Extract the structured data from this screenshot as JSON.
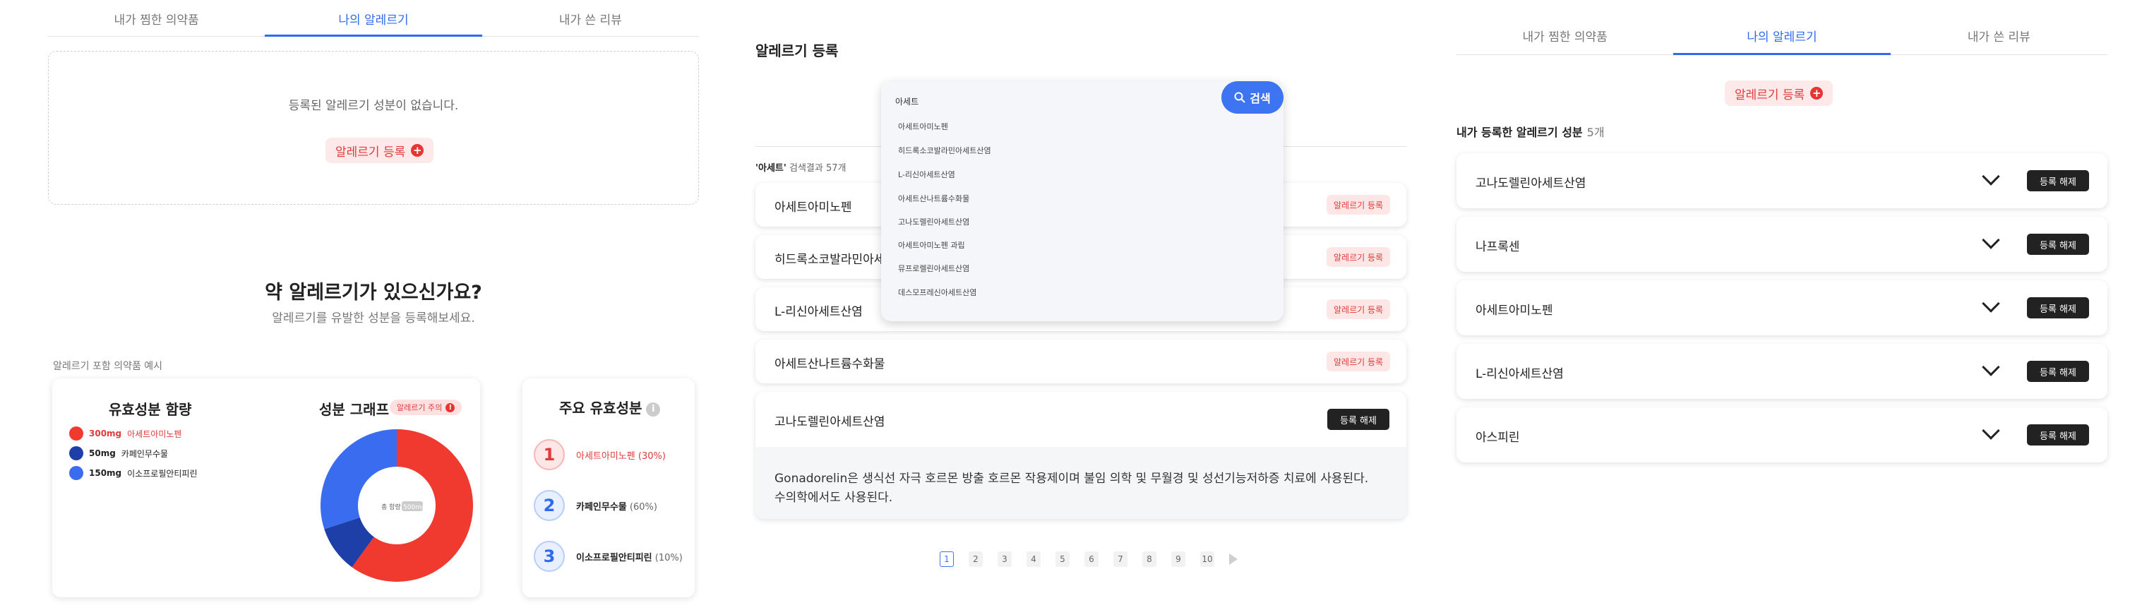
{
  "tabs": [
    {
      "label": "내가 찜한 의약품"
    },
    {
      "label": "나의 알레르기"
    },
    {
      "label": "내가 쓴 리뷰"
    }
  ],
  "empty_state": {
    "message": "등록된 알레르기 성분이 없습니다.",
    "register_label": "알레르기 등록"
  },
  "promo": {
    "headline": "약 알레르기가 있으신가요?",
    "subline": "알레르기를 유발한 성분을 등록해보세요.",
    "example_caption": "알레르기 포함 의약품 예시"
  },
  "ingredients_card": {
    "title": "유효성분 함량",
    "items": [
      {
        "amount": "300mg",
        "name": "아세트아미노펜",
        "color": "#f0392f"
      },
      {
        "amount": "50mg",
        "name": "카페인무수물",
        "color": "#1f3fa8"
      },
      {
        "amount": "150mg",
        "name": "이소프로필안티피린",
        "color": "#3a6cf0"
      }
    ]
  },
  "graph_card": {
    "title": "성분 그래프",
    "allergy_badge": "알레르기 주의",
    "center_label": "총 함량",
    "center_value": "500mg"
  },
  "chart_data": {
    "type": "pie",
    "categories": [
      "아세트아미노펜",
      "카페인무수물",
      "이소프로필안티피린"
    ],
    "values": [
      300,
      50,
      150
    ],
    "colors": [
      "#f0392f",
      "#1f3fa8",
      "#3a6cf0"
    ]
  },
  "main_ingredients": {
    "title": "주요 유효성분",
    "items": [
      {
        "rank": "1",
        "name": "아세트아미노펜",
        "pct": "(30%)"
      },
      {
        "rank": "2",
        "name": "카페인무수물",
        "pct": "(60%)"
      },
      {
        "rank": "3",
        "name": "이소프로필안티피린",
        "pct": "(10%)"
      }
    ]
  },
  "register_page": {
    "title": "알레르기 등록",
    "search_value": "아세트",
    "search_button": "검색",
    "suggestions": [
      "아세트아미노펜",
      "히드록소코발라민아세트산염",
      "L-리신아세트산염",
      "아세트산나트륨수화물",
      "고나도렐린아세트산염",
      "아세트아미노펜 과립",
      "뮤프로렐린아세트산염",
      "데스모프레신아세트산염"
    ],
    "result_query": "'아세트'",
    "result_suffix": "검색결과 57개",
    "rows": [
      {
        "label": "아세트아미노펜",
        "action": "알레르기 등록"
      },
      {
        "label": "히드록소코발라민아세트산염",
        "action": "알레르기 등록"
      },
      {
        "label": "L-리신아세트산염",
        "action": "알레르기 등록"
      },
      {
        "label": "아세트산나트륨수화물",
        "action": "알레르기 등록"
      },
      {
        "label": "고나도렐린아세트산염",
        "action": "등록 해제"
      }
    ],
    "expanded_description": "Gonadorelin은 생식선 자극 호르몬 방출 호르몬 작용제이며 불임 의학 및 무월경 및 성선기능저하증 치료에 사용된다. 수의학에서도 사용된다.",
    "pages": [
      "1",
      "2",
      "3",
      "4",
      "5",
      "6",
      "7",
      "8",
      "9",
      "10"
    ]
  },
  "my_allergies": {
    "register_label": "알레르기 등록",
    "count_title": "내가 등록한 알레르기 성분",
    "count_value": "5개",
    "unregister_label": "등록 해제",
    "rows": [
      "고나도렐린아세트산염",
      "나프록센",
      "아세트아미노펜",
      "L-리신아세트산염",
      "아스피린"
    ]
  }
}
